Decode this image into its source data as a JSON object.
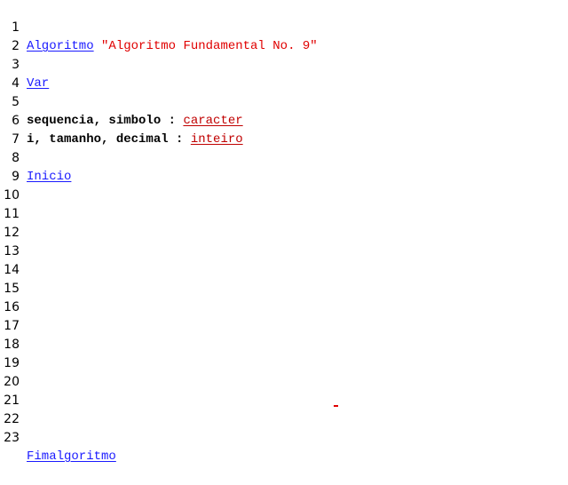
{
  "editor": {
    "lines": [
      {
        "num": "1",
        "kw": "Algoritmo",
        "str": "\"Algoritmo Fundamental No. 9\""
      },
      {
        "num": "2"
      },
      {
        "num": "3",
        "kw": "Var"
      },
      {
        "num": "4"
      },
      {
        "num": "5",
        "text": "sequencia, simbolo : ",
        "type": "caracter"
      },
      {
        "num": "6",
        "text": "i, tamanho, decimal : ",
        "type": "inteiro"
      },
      {
        "num": "7"
      },
      {
        "num": "8",
        "kw": "Inicio"
      },
      {
        "num": "9"
      },
      {
        "num": "10"
      },
      {
        "num": "11"
      },
      {
        "num": "12"
      },
      {
        "num": "13"
      },
      {
        "num": "14"
      },
      {
        "num": "15"
      },
      {
        "num": "16"
      },
      {
        "num": "17"
      },
      {
        "num": "18"
      },
      {
        "num": "19"
      },
      {
        "num": "20"
      },
      {
        "num": "21"
      },
      {
        "num": "22"
      },
      {
        "num": "23",
        "kw": "Fimalgoritmo"
      }
    ]
  },
  "colors": {
    "keyword": "#1a1aff",
    "string": "#e00000",
    "type": "#c00000",
    "background": "#ffffff"
  }
}
